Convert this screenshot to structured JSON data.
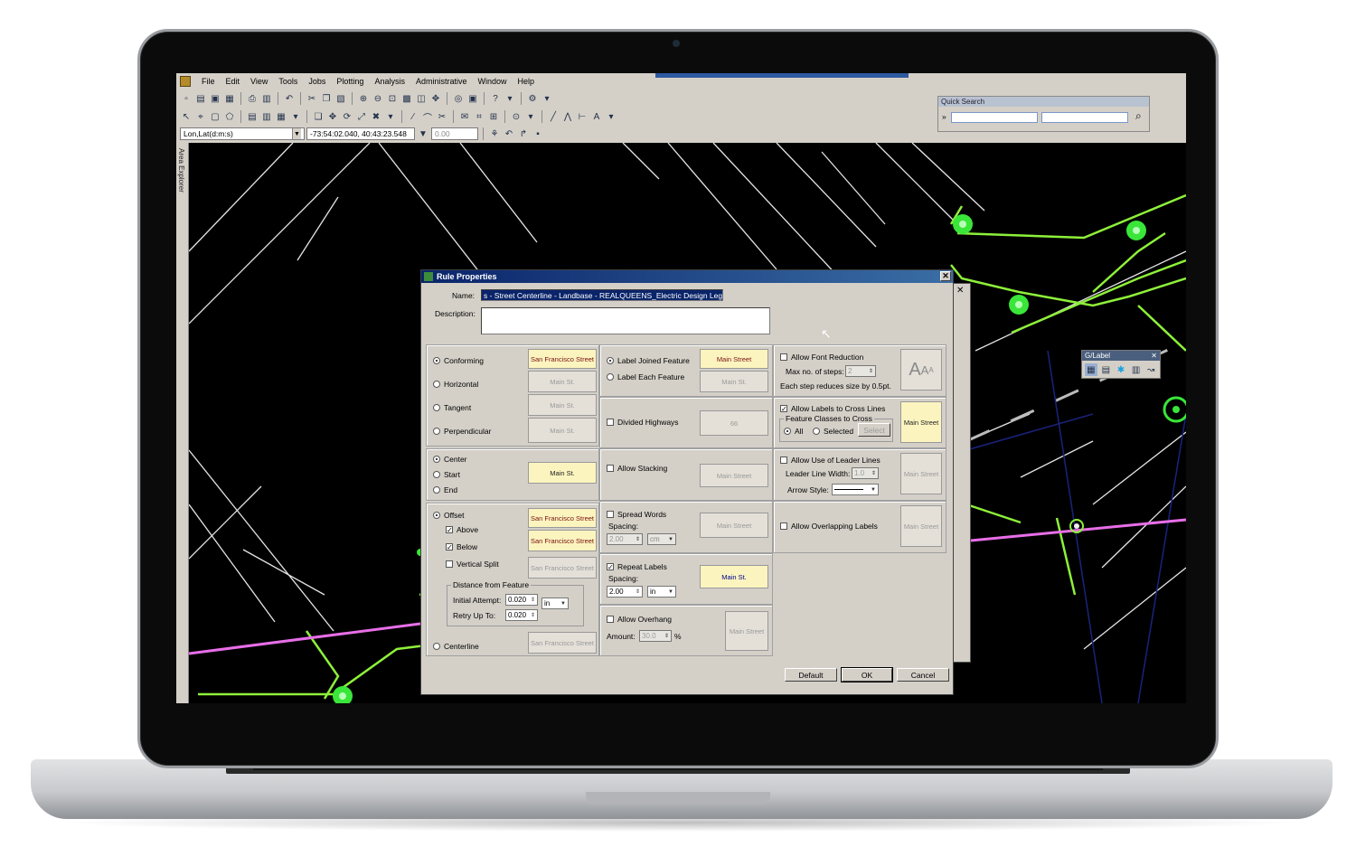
{
  "menu": [
    "File",
    "Edit",
    "View",
    "Tools",
    "Jobs",
    "Plotting",
    "Analysis",
    "Administrative",
    "Window",
    "Help"
  ],
  "coords": {
    "system": "Lon,Lat(d:m:s)",
    "position": "-73:54:02.040, 40:43:23.548",
    "value": "0.00"
  },
  "quick_search": {
    "title": "Quick Search"
  },
  "side_panel": {
    "label": "Area Explorer"
  },
  "glabel": {
    "title": "G/Label",
    "close": "✕"
  },
  "dialog": {
    "title": "Rule Properties",
    "close": "✕",
    "name_label": "Name:",
    "name_value": "s - Street Centerline - Landbase - REALQUEENS_Electric Design Legend",
    "description_label": "Description:",
    "description_value": "",
    "orientation": {
      "conforming": "Conforming",
      "horizontal": "Horizontal",
      "tangent": "Tangent",
      "perpendicular": "Perpendicular"
    },
    "position": {
      "center": "Center",
      "start": "Start",
      "end": "End"
    },
    "offset": {
      "offset": "Offset",
      "above": "Above",
      "below": "Below",
      "vertical_split": "Vertical Split",
      "distance_legend": "Distance from Feature",
      "initial_label": "Initial Attempt:",
      "initial_value": "0.020",
      "retry_label": "Retry Up To:",
      "retry_value": "0.020",
      "unit": "in",
      "centerline": "Centerline"
    },
    "joined": {
      "label_joined": "Label Joined Feature",
      "label_each": "Label Each Feature"
    },
    "divided_highways": "Divided Highways",
    "allow_stacking": "Allow Stacking",
    "spread": {
      "label": "Spread Words",
      "spacing_label": "Spacing:",
      "spacing_value": "2.00",
      "unit": "cm"
    },
    "repeat": {
      "label": "Repeat Labels",
      "spacing_label": "Spacing:",
      "spacing_value": "2.00",
      "unit": "in"
    },
    "overhang": {
      "label": "Allow Overhang",
      "amount_label": "Amount:",
      "amount_value": "30.0",
      "pct": "%"
    },
    "font_reduction": {
      "label": "Allow Font Reduction",
      "steps_label": "Max no. of steps:",
      "steps_value": "2",
      "note": "Each step reduces size by 0.5pt."
    },
    "cross_lines": {
      "label": "Allow Labels to Cross Lines",
      "classes_legend": "Feature Classes to Cross",
      "all": "All",
      "selected": "Selected",
      "select_button": "Select"
    },
    "leader": {
      "label": "Allow Use of Leader Lines",
      "width_label": "Leader Line Width:",
      "width_value": "1.0",
      "style_label": "Arrow Style:"
    },
    "overlap": "Allow Overlapping Labels",
    "buttons": {
      "default": "Default",
      "ok": "OK",
      "cancel": "Cancel"
    },
    "previews": {
      "san_francisco_street": "San Francisco Street",
      "main_st": "Main St.",
      "main_street": "Main Street",
      "highway_shield": "66",
      "san_francisco_street_split": "San Francisco Street"
    }
  },
  "colors": {
    "map_background": "#000000",
    "feature_green": "#8ef03a",
    "node_green": "#39e639",
    "pink_line": "#e86ee8",
    "navy_line": "#1a237e",
    "title_bar": "#0a246a"
  }
}
